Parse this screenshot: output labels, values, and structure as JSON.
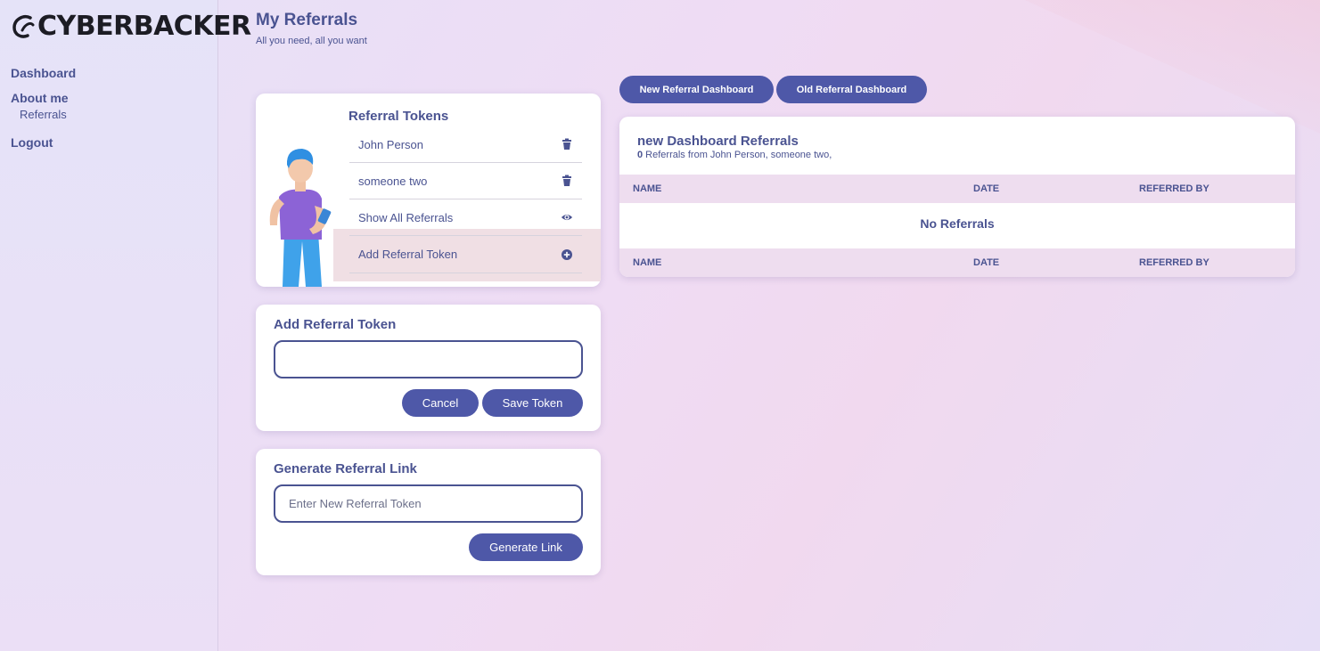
{
  "brand": {
    "name": "CYBERBACKER"
  },
  "sidebar": {
    "items": [
      {
        "label": "Dashboard"
      },
      {
        "label": "About me"
      },
      {
        "label": "Referrals"
      },
      {
        "label": "Logout"
      }
    ]
  },
  "header": {
    "title": "My Referrals",
    "subtitle": "All you need, all you want"
  },
  "tokens": {
    "title": "Referral Tokens",
    "items": [
      {
        "label": "John Person",
        "icon": "trash-icon"
      },
      {
        "label": "someone two",
        "icon": "trash-icon"
      },
      {
        "label": "Show All Referrals",
        "icon": "eye-icon"
      }
    ],
    "add_label": "Add Referral Token",
    "add_icon": "plus-circle-icon"
  },
  "add_token": {
    "title": "Add Referral Token",
    "value": "",
    "cancel_label": "Cancel",
    "save_label": "Save Token"
  },
  "generate": {
    "title": "Generate Referral Link",
    "placeholder": "Enter New Referral Token",
    "button_label": "Generate Link"
  },
  "dashboard_tabs": {
    "new_label": "New Referral Dashboard",
    "old_label": "Old Referral Dashboard"
  },
  "referrals": {
    "title": "new Dashboard Referrals",
    "count": "0",
    "summary": " Referrals from John Person, someone two,",
    "columns": [
      "NAME",
      "DATE",
      "REFERRED BY"
    ],
    "empty_text": "No Referrals"
  },
  "colors": {
    "accent": "#4e58a8",
    "text": "#4a5391",
    "highlight_row": "#f0dfe4",
    "table_header": "#eeddef"
  }
}
